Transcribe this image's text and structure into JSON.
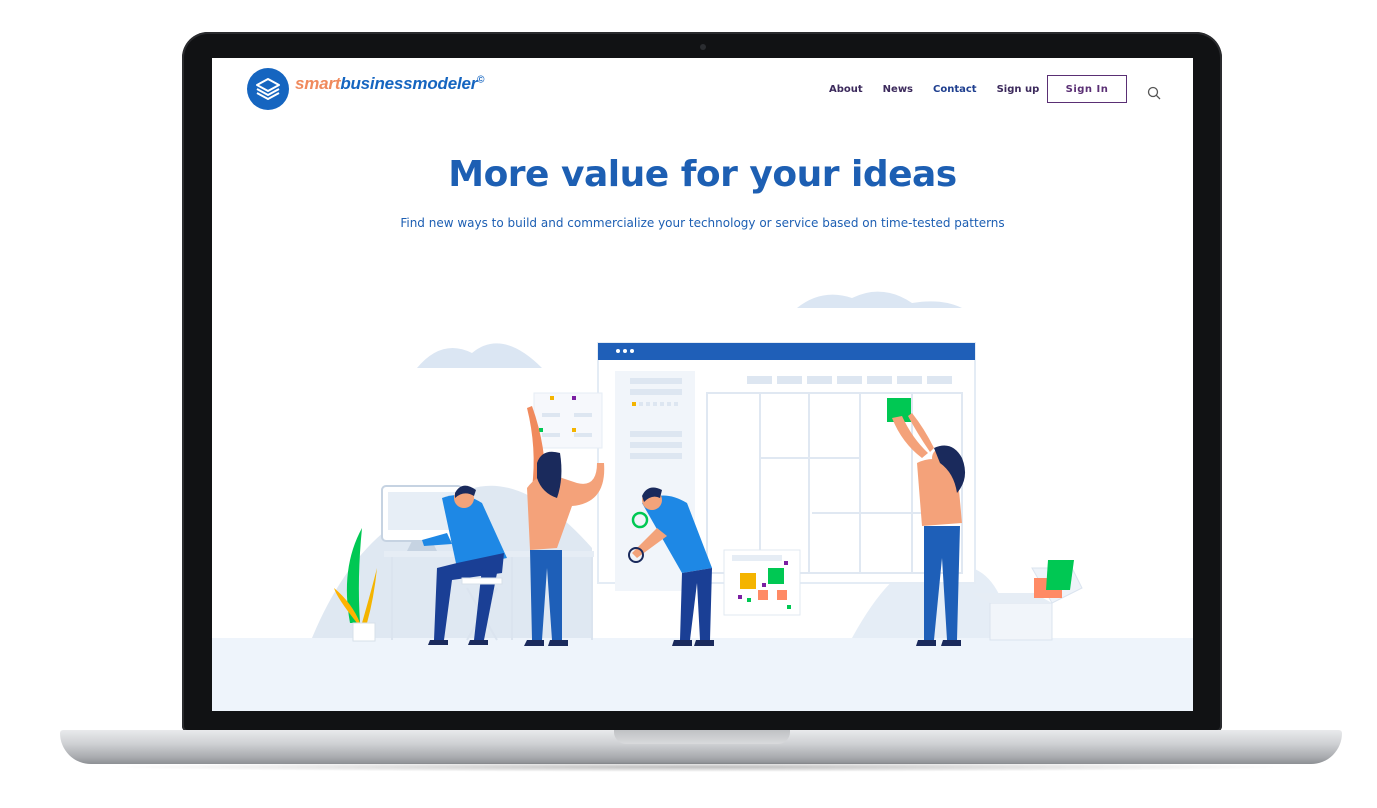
{
  "brand": {
    "name_prefix": "smart",
    "name_suffix": "businessmodeler",
    "mark": "©",
    "colors": {
      "primary": "#1565c0",
      "accent": "#f08a5d",
      "nav": "#3c2a5c",
      "button": "#5a2f74"
    }
  },
  "nav": {
    "items": [
      {
        "label": "About"
      },
      {
        "label": "News"
      },
      {
        "label": "Contact"
      },
      {
        "label": "Sign up"
      }
    ],
    "signin_label": "Sign In",
    "search_icon": "search-icon"
  },
  "hero": {
    "title": "More value for your ideas",
    "subtitle": "Find new ways to build and commercialize your technology or service based on time-tested patterns"
  }
}
